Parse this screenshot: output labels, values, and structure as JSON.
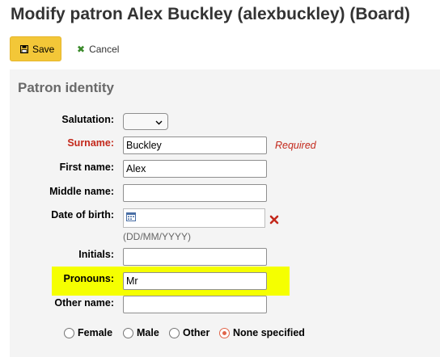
{
  "page": {
    "title": "Modify patron Alex Buckley (alexbuckley) (Board)"
  },
  "toolbar": {
    "save_label": "Save",
    "cancel_label": "Cancel"
  },
  "identity": {
    "legend": "Patron identity",
    "salutation": {
      "label": "Salutation:",
      "value": ""
    },
    "surname": {
      "label": "Surname:",
      "value": "Buckley",
      "required_hint": "Required"
    },
    "firstname": {
      "label": "First name:",
      "value": "Alex"
    },
    "middlename": {
      "label": "Middle name:",
      "value": ""
    },
    "dateofbirth": {
      "label": "Date of birth:",
      "value": "",
      "hint": "(DD/MM/YYYY)"
    },
    "initials": {
      "label": "Initials:",
      "value": ""
    },
    "pronouns": {
      "label": "Pronouns:",
      "value": "Mr"
    },
    "othernames": {
      "label": "Other name:",
      "value": ""
    },
    "gender": {
      "options": [
        "Female",
        "Male",
        "Other",
        "None specified"
      ],
      "selected": "None specified"
    }
  },
  "colors": {
    "save_button": "#f3c738",
    "required": "#c3281b",
    "highlight": "#f5ff00",
    "cancel_icon": "#3a8a2a",
    "fieldset_bg": "#f4f4f4"
  }
}
